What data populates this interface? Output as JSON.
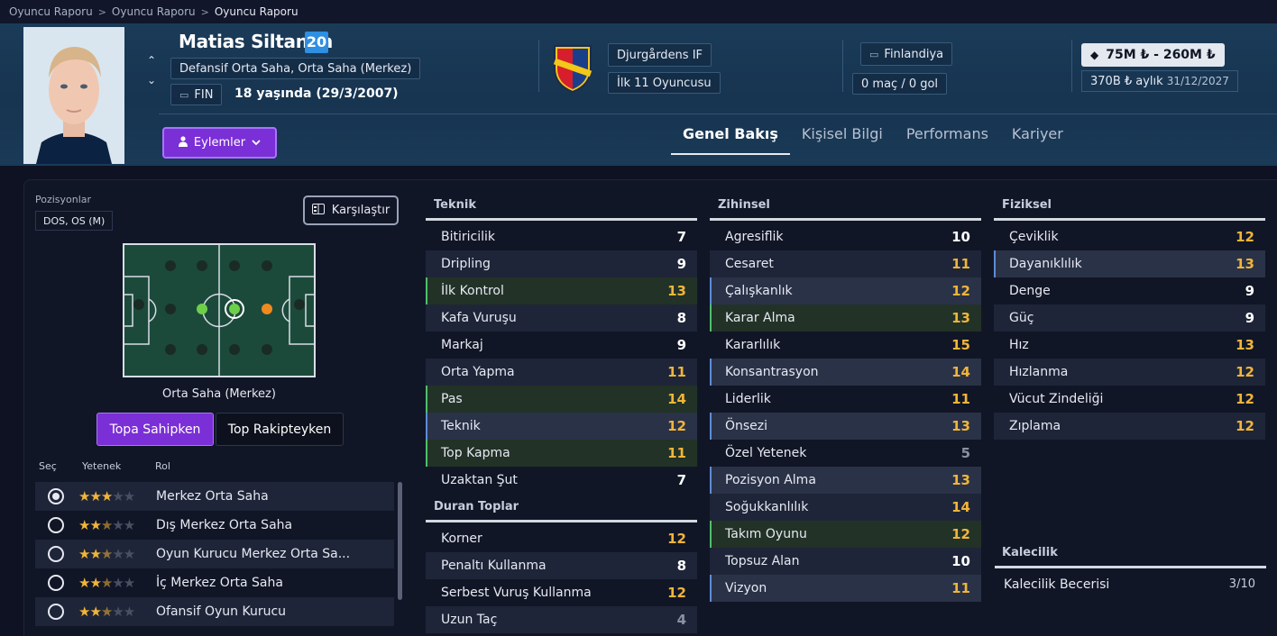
{
  "breadcrumb": [
    "Oyuncu Raporu",
    "Oyuncu Raporu",
    "Oyuncu Raporu"
  ],
  "player": {
    "name": "Matias Siltanen",
    "number": "20",
    "positions_long": "Defansif Orta Saha, Orta Saha (Merkez)",
    "nationality_code": "FIN",
    "age_text": "18 yaşında (29/3/2007)",
    "club": "Djurgårdens IF",
    "squad_status": "İlk 11 Oyuncusu",
    "nation": "Finlandiya",
    "caps": "0 maç / 0 gol",
    "value": "75M ₺ - 260M ₺",
    "wage": "370B ₺ aylık",
    "contract_end": "31/12/2027"
  },
  "actions_label": "Eylemler",
  "tabs": [
    "Genel Bakış",
    "Kişisel Bilgi",
    "Performans",
    "Kariyer"
  ],
  "left": {
    "positions_label": "Pozisyonlar",
    "positions_short": "DOS, OS (M)",
    "compare_label": "Karşılaştır",
    "pitch_label": "Orta Saha (Merkez)",
    "toggle_on": "Topa Sahipken",
    "toggle_off": "Top Rakipteyken",
    "headers": {
      "select": "Seç",
      "ability": "Yetenek",
      "role": "Rol"
    },
    "roles": [
      {
        "name": "Merkez Orta Saha",
        "stars": 3,
        "selected": true
      },
      {
        "name": "Dış Merkez Orta Saha",
        "stars": 2.5,
        "selected": false
      },
      {
        "name": "Oyun Kurucu Merkez Orta Sa...",
        "stars": 2.5,
        "selected": false
      },
      {
        "name": "İç Merkez Orta Saha",
        "stars": 2.5,
        "selected": false
      },
      {
        "name": "Ofansif Oyun Kurucu",
        "stars": 2.5,
        "selected": false
      }
    ]
  },
  "attributes": {
    "teknik": {
      "title": "Teknik",
      "items": [
        {
          "name": "Bitiricilik",
          "value": "7"
        },
        {
          "name": "Dripling",
          "value": "9"
        },
        {
          "name": "İlk Kontrol",
          "value": "13"
        },
        {
          "name": "Kafa Vuruşu",
          "value": "8"
        },
        {
          "name": "Markaj",
          "value": "9"
        },
        {
          "name": "Orta Yapma",
          "value": "11"
        },
        {
          "name": "Pas",
          "value": "14"
        },
        {
          "name": "Teknik",
          "value": "12"
        },
        {
          "name": "Top Kapma",
          "value": "11"
        },
        {
          "name": "Uzaktan Şut",
          "value": "7"
        }
      ]
    },
    "duran": {
      "title": "Duran Toplar",
      "items": [
        {
          "name": "Korner",
          "value": "12"
        },
        {
          "name": "Penaltı Kullanma",
          "value": "8"
        },
        {
          "name": "Serbest Vuruş Kullanma",
          "value": "12"
        },
        {
          "name": "Uzun Taç",
          "value": "4"
        }
      ]
    },
    "zihinsel": {
      "title": "Zihinsel",
      "items": [
        {
          "name": "Agresiflik",
          "value": "10"
        },
        {
          "name": "Cesaret",
          "value": "11"
        },
        {
          "name": "Çalışkanlık",
          "value": "12"
        },
        {
          "name": "Karar Alma",
          "value": "13"
        },
        {
          "name": "Kararlılık",
          "value": "15"
        },
        {
          "name": "Konsantrasyon",
          "value": "14"
        },
        {
          "name": "Liderlik",
          "value": "11"
        },
        {
          "name": "Önsezi",
          "value": "13"
        },
        {
          "name": "Özel Yetenek",
          "value": "5"
        },
        {
          "name": "Pozisyon Alma",
          "value": "13"
        },
        {
          "name": "Soğukkanlılık",
          "value": "14"
        },
        {
          "name": "Takım Oyunu",
          "value": "12"
        },
        {
          "name": "Topsuz Alan",
          "value": "10"
        },
        {
          "name": "Vizyon",
          "value": "11"
        }
      ]
    },
    "fiziksel": {
      "title": "Fiziksel",
      "items": [
        {
          "name": "Çeviklik",
          "value": "12"
        },
        {
          "name": "Dayanıklılık",
          "value": "13"
        },
        {
          "name": "Denge",
          "value": "9"
        },
        {
          "name": "Güç",
          "value": "9"
        },
        {
          "name": "Hız",
          "value": "13"
        },
        {
          "name": "Hızlanma",
          "value": "12"
        },
        {
          "name": "Vücut Zindeliği",
          "value": "12"
        },
        {
          "name": "Zıplama",
          "value": "12"
        }
      ]
    },
    "kalecilik": {
      "title": "Kalecilik",
      "skill_label": "Kalecilik Becerisi",
      "skill_value": "3/10"
    }
  },
  "colors": {
    "accent_purple": "#7b2fd6",
    "number_badge": "#2f8fe0",
    "value_high": "#f0b53a",
    "value_normal": "#ffffff",
    "value_low": "#8b91a3",
    "highlight_green": "#4fbf6a",
    "highlight_blue": "#5e8cd6"
  }
}
